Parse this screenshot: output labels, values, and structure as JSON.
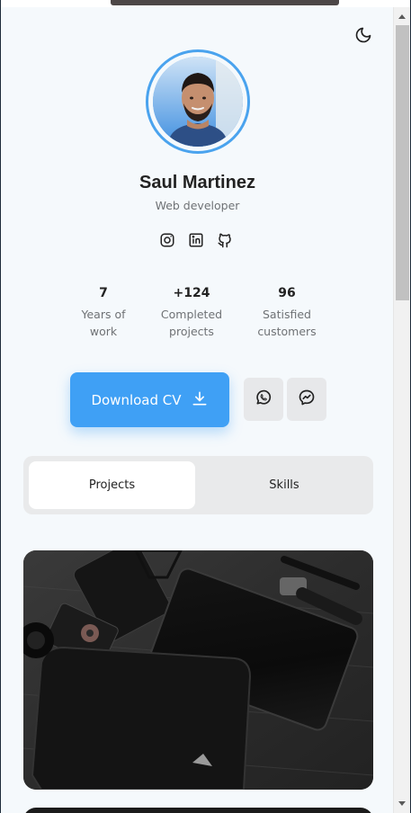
{
  "profile": {
    "name": "Saul Martinez",
    "role": "Web developer"
  },
  "icons": {
    "theme_toggle": "moon-icon",
    "socials": [
      "instagram-icon",
      "linkedin-icon",
      "github-icon"
    ],
    "download": "download-icon",
    "whatsapp": "whatsapp-icon",
    "messenger": "messenger-icon"
  },
  "stats": [
    {
      "value": "7",
      "label_line1": "Years of",
      "label_line2": "work"
    },
    {
      "value": "+124",
      "label_line1": "Completed",
      "label_line2": "projects"
    },
    {
      "value": "96",
      "label_line1": "Satisfied",
      "label_line2": "customers"
    }
  ],
  "actions": {
    "download_label": "Download CV"
  },
  "tabs": [
    {
      "label": "Projects",
      "active": true
    },
    {
      "label": "Skills",
      "active": false
    }
  ],
  "colors": {
    "accent": "#3fa0f5",
    "background": "#f5f9fc"
  }
}
